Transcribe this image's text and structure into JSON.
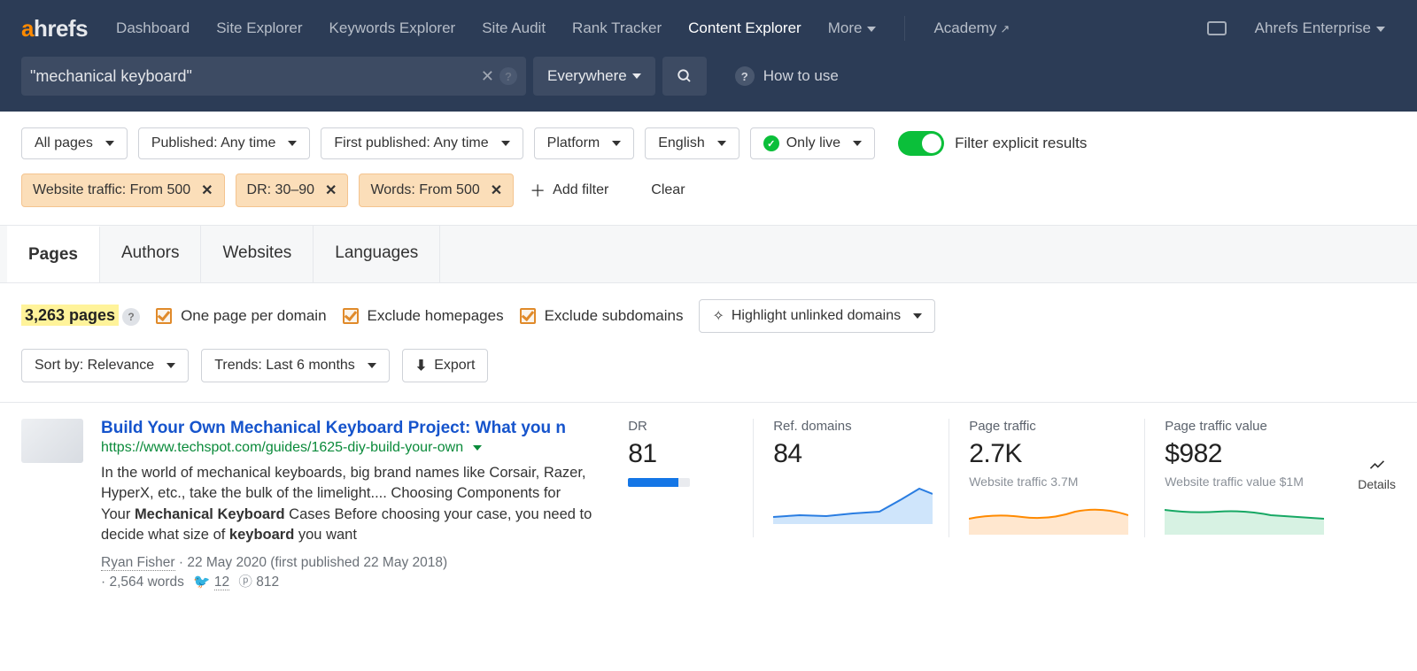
{
  "brand": {
    "a": "a",
    "rest": "hrefs"
  },
  "nav": {
    "items": [
      "Dashboard",
      "Site Explorer",
      "Keywords Explorer",
      "Site Audit",
      "Rank Tracker",
      "Content Explorer",
      "More"
    ],
    "active": "Content Explorer",
    "academy": "Academy",
    "account": "Ahrefs Enterprise"
  },
  "search": {
    "query": "\"mechanical keyboard\"",
    "scope": "Everywhere",
    "howto": "How to use"
  },
  "filters_row1": {
    "all_pages": "All pages",
    "published": "Published: Any time",
    "first_published": "First published: Any time",
    "platform": "Platform",
    "language": "English",
    "only_live": "Only live",
    "explicit": "Filter explicit results"
  },
  "filters_active": [
    "Website traffic: From 500",
    "DR: 30–90",
    "Words: From 500"
  ],
  "add_filter": "Add filter",
  "clear": "Clear",
  "tabs": [
    "Pages",
    "Authors",
    "Websites",
    "Languages"
  ],
  "tabs_active": "Pages",
  "summary": {
    "count": "3,263 pages",
    "one_per_domain": "One page per domain",
    "exclude_home": "Exclude homepages",
    "exclude_sub": "Exclude subdomains",
    "highlight_unlinked": "Highlight unlinked domains"
  },
  "sort": {
    "sort_by": "Sort by: Relevance",
    "trends": "Trends: Last 6 months",
    "export": "Export"
  },
  "result": {
    "title": "Build Your Own Mechanical Keyboard Project: What you n",
    "url": "https://www.techspot.com/guides/1625-diy-build-your-own",
    "desc_pre": "In the world of mechanical keyboards, big brand names like Corsair, Razer, HyperX, etc., take the bulk of the limelight.... Choosing Components for Your ",
    "desc_bold1": "Mechanical Keyboard",
    "desc_mid": " Cases Before choosing your case, you need to decide what size of ",
    "desc_bold2": "keyboard",
    "desc_post": " you want",
    "author": "Ryan Fisher",
    "date": "22 May 2020 (first published 22 May 2018)",
    "words": "2,564 words",
    "tw": "12",
    "pin": "812",
    "metrics": {
      "dr": {
        "label": "DR",
        "value": "81"
      },
      "rd": {
        "label": "Ref. domains",
        "value": "84"
      },
      "pt": {
        "label": "Page traffic",
        "value": "2.7K",
        "sub": "Website traffic 3.7M"
      },
      "ptv": {
        "label": "Page traffic value",
        "value": "$982",
        "sub": "Website traffic value $1M"
      }
    },
    "details": "Details"
  }
}
